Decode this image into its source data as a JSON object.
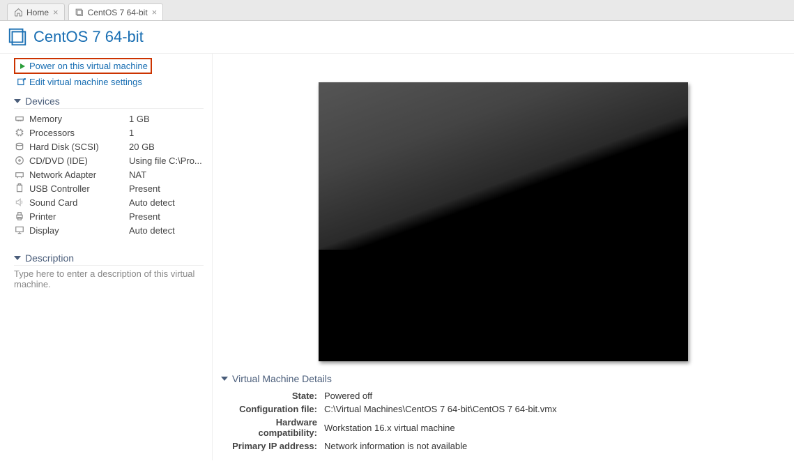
{
  "tabs": [
    {
      "label": "Home"
    },
    {
      "label": "CentOS 7 64-bit"
    }
  ],
  "vm": {
    "name": "CentOS 7 64-bit"
  },
  "actions": {
    "power_on": "Power on this virtual machine",
    "edit": "Edit virtual machine settings"
  },
  "sections": {
    "devices": "Devices",
    "description": "Description",
    "details": "Virtual Machine Details"
  },
  "devices": [
    {
      "name": "Memory",
      "value": "1 GB"
    },
    {
      "name": "Processors",
      "value": "1"
    },
    {
      "name": "Hard Disk (SCSI)",
      "value": "20 GB"
    },
    {
      "name": "CD/DVD (IDE)",
      "value": "Using file C:\\Pro..."
    },
    {
      "name": "Network Adapter",
      "value": "NAT"
    },
    {
      "name": "USB Controller",
      "value": "Present"
    },
    {
      "name": "Sound Card",
      "value": "Auto detect"
    },
    {
      "name": "Printer",
      "value": "Present"
    },
    {
      "name": "Display",
      "value": "Auto detect"
    }
  ],
  "description_placeholder": "Type here to enter a description of this virtual machine.",
  "details": {
    "state_label": "State:",
    "state": "Powered off",
    "config_label": "Configuration file:",
    "config": "C:\\Virtual Machines\\CentOS 7 64-bit\\CentOS 7 64-bit.vmx",
    "hw_label": "Hardware compatibility:",
    "hw": "Workstation 16.x virtual machine",
    "ip_label": "Primary IP address:",
    "ip": "Network information is not available"
  }
}
